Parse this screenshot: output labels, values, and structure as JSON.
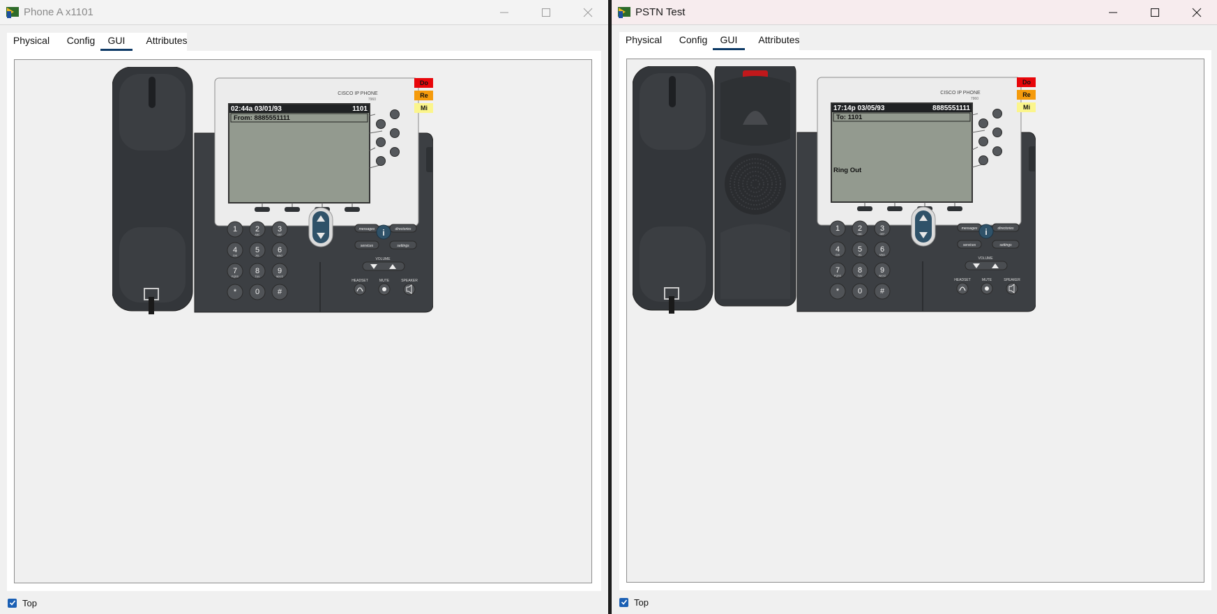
{
  "windows": {
    "left": {
      "title": "Phone A x1101",
      "tabs": [
        {
          "label": "Physical"
        },
        {
          "label": "Config"
        },
        {
          "label": "GUI"
        },
        {
          "label": "Attributes"
        }
      ],
      "active_tab": "GUI",
      "footer": {
        "top_label": "Top",
        "top_checked": true
      },
      "phone": {
        "brand": "CISCO IP PHONE",
        "model": "7960",
        "lcd_time": "02:44a 03/01/93",
        "lcd_ext": "1101",
        "lcd_line": "From: 8885551111",
        "lcd_status": "",
        "line_labels": [
          "Do",
          "Re",
          "Mi"
        ]
      }
    },
    "right": {
      "title": "PSTN Test",
      "tabs": [
        {
          "label": "Physical"
        },
        {
          "label": "Config"
        },
        {
          "label": "GUI"
        },
        {
          "label": "Attributes"
        }
      ],
      "active_tab": "GUI",
      "footer": {
        "top_label": "Top",
        "top_checked": true
      },
      "phone": {
        "brand": "CISCO IP PHONE",
        "model": "7960",
        "lcd_time": "17:14p 03/05/93",
        "lcd_ext": "8885551111",
        "lcd_line": "To: 1101",
        "lcd_status": "Ring Out",
        "line_labels": [
          "Do",
          "Re",
          "Mi"
        ]
      }
    }
  },
  "keypad": {
    "keys": [
      {
        "digit": "1",
        "letters": ""
      },
      {
        "digit": "2",
        "letters": "ABC"
      },
      {
        "digit": "3",
        "letters": "DEF"
      },
      {
        "digit": "4",
        "letters": "GHI"
      },
      {
        "digit": "5",
        "letters": "JKL"
      },
      {
        "digit": "6",
        "letters": "MNO"
      },
      {
        "digit": "7",
        "letters": "PQRS"
      },
      {
        "digit": "8",
        "letters": "TUV"
      },
      {
        "digit": "9",
        "letters": "WXYZ"
      },
      {
        "digit": "*",
        "letters": ""
      },
      {
        "digit": "0",
        "letters": ""
      },
      {
        "digit": "#",
        "letters": ""
      }
    ],
    "messages_label": "messages",
    "directories_label": "directories",
    "services_label": "services",
    "settings_label": "settings",
    "info_label": "i",
    "volume_label": "VOLUME",
    "headset_label": "HEADSET",
    "mute_label": "MUTE",
    "speaker_label": "SPEAKER"
  },
  "colors": {
    "lcd_bg": "#939a8f",
    "phone_body": "#3c3f43",
    "handset": "#34373b",
    "line_do": "#e8060a",
    "line_re": "#f59b0c",
    "line_mi": "#fbf58c",
    "tab_underline": "#0e3a66",
    "checkbox": "#1a5fb4"
  }
}
